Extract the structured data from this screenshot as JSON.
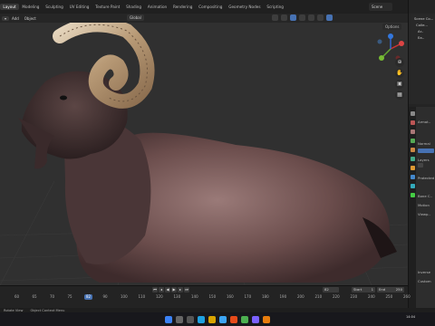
{
  "app": {
    "accent": "#4772b3",
    "viewport_bg": "#303030"
  },
  "topbar": {
    "workspaces": [
      "Layout",
      "Modeling",
      "Sculpting",
      "UV Editing",
      "Texture Paint",
      "Shading",
      "Animation",
      "Rendering",
      "Compositing",
      "Geometry Nodes",
      "Scripting"
    ],
    "active": "Layout",
    "scene": "Scene"
  },
  "toolbar": {
    "items": [
      "Add",
      "Object"
    ],
    "orientation": "Global"
  },
  "viewport": {
    "options_label": "Options"
  },
  "outliner": {
    "items": [
      "Scene Co...",
      "Colle...",
      "Ar..",
      "Ea.."
    ]
  },
  "properties": {
    "labels": [
      "Armat..",
      "Normal",
      "Layers",
      "Protected",
      "Bone C..",
      "Motion",
      "Viewp..",
      "Inverse",
      "Custom"
    ]
  },
  "timeline": {
    "ticks": [
      "60",
      "65",
      "70",
      "75",
      "80",
      "90",
      "100",
      "110",
      "120",
      "130",
      "140",
      "150",
      "160",
      "170",
      "180",
      "190",
      "200",
      "210",
      "220",
      "230",
      "240",
      "250",
      "260"
    ],
    "current_frame": "82",
    "start_label": "Start",
    "start_value": "1",
    "end_label": "End",
    "end_value": "250"
  },
  "statusbar": {
    "items": [
      "Rotate View",
      "Object Context Menu"
    ]
  },
  "taskbar": {
    "clock": "14:04",
    "date": "..."
  }
}
